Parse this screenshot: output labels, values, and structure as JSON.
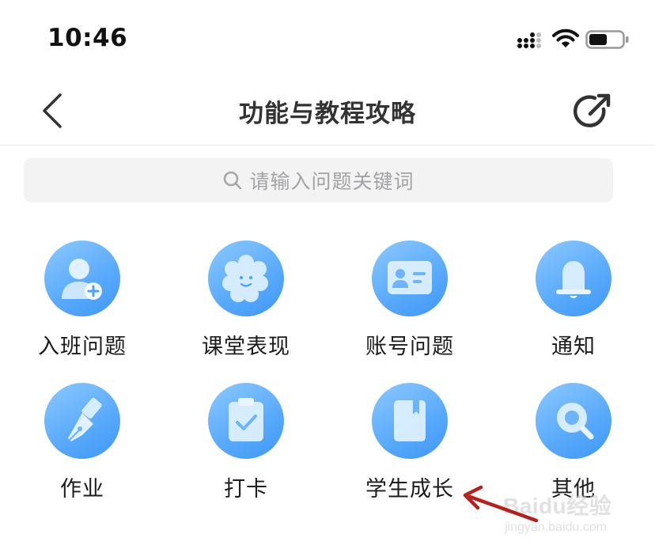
{
  "status_bar": {
    "time": "10:46"
  },
  "nav": {
    "title": "功能与教程攻略"
  },
  "search": {
    "placeholder": "请输入问题关键词"
  },
  "categories": [
    {
      "label": "入班问题",
      "icon": "add-user-icon"
    },
    {
      "label": "课堂表现",
      "icon": "flower-face-icon"
    },
    {
      "label": "账号问题",
      "icon": "id-card-icon"
    },
    {
      "label": "通知",
      "icon": "bell-icon"
    },
    {
      "label": "作业",
      "icon": "pen-nib-icon"
    },
    {
      "label": "打卡",
      "icon": "clipboard-check-icon"
    },
    {
      "label": "学生成长",
      "icon": "book-icon"
    },
    {
      "label": "其他",
      "icon": "magnifier-icon"
    }
  ],
  "annotation": {
    "arrow_color": "#b3221c"
  },
  "watermark": {
    "main": "Baidu经验",
    "sub": "jingyan.baidu.com"
  },
  "colors": {
    "icon_gradient_start": "#8cc9ff",
    "icon_gradient_end": "#3f97f6"
  }
}
